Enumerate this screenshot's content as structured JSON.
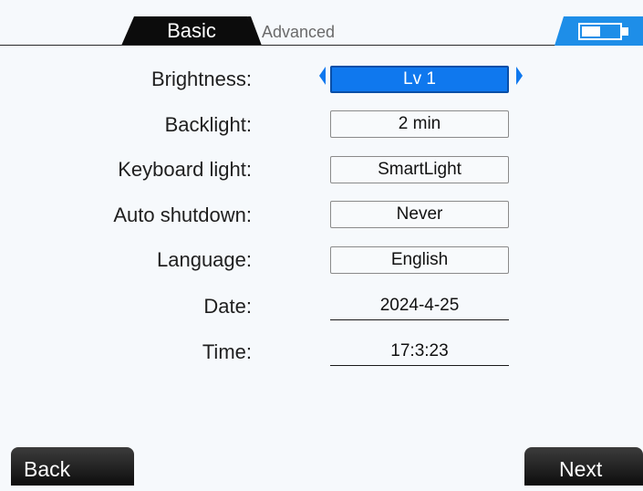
{
  "tabs": {
    "basic_label": "Basic",
    "advanced_label": "Advanced",
    "active": "Basic"
  },
  "battery": {
    "level_fraction": 0.5,
    "icon": "battery-icon"
  },
  "settings": {
    "brightness": {
      "label": "Brightness:",
      "value": "Lv 1"
    },
    "backlight": {
      "label": "Backlight:",
      "value": "2 min"
    },
    "keyboard_light": {
      "label": "Keyboard light:",
      "value": "SmartLight"
    },
    "auto_shutdown": {
      "label": "Auto shutdown:",
      "value": "Never"
    },
    "language": {
      "label": "Language:",
      "value": "English"
    },
    "date": {
      "label": "Date:",
      "value": "2024-4-25"
    },
    "time": {
      "label": "Time:",
      "value": "17:3:23"
    }
  },
  "buttons": {
    "back_label": "Back",
    "next_label": "Next"
  },
  "colors": {
    "accent": "#0f78ee",
    "battery": "#1e8ee8",
    "tab_active": "#0c0c0c"
  }
}
